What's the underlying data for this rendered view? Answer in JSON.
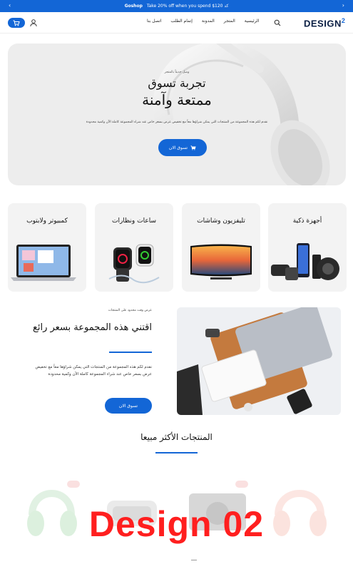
{
  "topbar": {
    "brand": "Goshop",
    "message": "Take 20% off when you spend $120 كد",
    "prev_icon": "chevron-left-icon",
    "next_icon": "chevron-right-icon"
  },
  "header": {
    "logo_text": "DESIGN",
    "logo_sup": "2",
    "nav": [
      "الرئيسية",
      "المتجر",
      "المدونة",
      "إتمام الطلب",
      "اتصل بنا"
    ],
    "icons": [
      "cart-icon",
      "user-icon",
      "search-icon"
    ]
  },
  "hero": {
    "small": "وصل حديثاً بالمتجر",
    "title1": "تجربة تسوق",
    "title2": "ممتعة وآمنة",
    "desc": "نقدم لكم هذه المجموعة من المنتجات التي يمكن شراؤها معاً مع تخفيض عرض بسعر خاص عند شراء المجموعة كاملة الآن وكمية محدودة",
    "button": "تسوق الان"
  },
  "categories": [
    "أجهزة ذكية",
    "تليفزيون وشاشات",
    "ساعات ونظارات",
    "كمبيوتر ولابتوب"
  ],
  "promo": {
    "kicker": "عرض وقت محدود على المنتجات",
    "title": "اقتني هذه المجموعة بسعر رائع",
    "desc": "نقدم لكم هذه المجموعة من المنتجات التي يمكن شراؤها معاً مع تخفيض عرض بسعر خاص عند شراء المجموعة كاملة الآن وكمية محدودة",
    "button": "تسوق الان"
  },
  "best_sellers": {
    "title": "المنتجات الأكثر مبيعا"
  },
  "watermark": "Design 02",
  "colors": {
    "accent": "#1366d6",
    "watermark": "#ff1f1f",
    "logo": "#0b1f44"
  }
}
